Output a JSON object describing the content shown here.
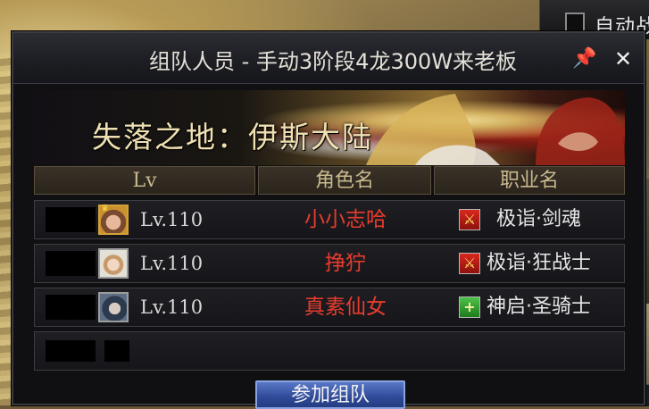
{
  "background": {
    "auto_checkbox_label": "自动战"
  },
  "window": {
    "title": "组队人员 - 手动3阶段4龙300W来老板",
    "pin_icon": "pin-icon",
    "close_icon": "close-icon",
    "pin_glyph": "📌",
    "close_glyph": "✕"
  },
  "banner": {
    "dungeon_name": "失落之地：伊斯大陆"
  },
  "table": {
    "headers": {
      "level": "Lv",
      "character_name": "角色名",
      "job_name": "职业名"
    },
    "rows": [
      {
        "level": "Lv.110",
        "name": "小小志哈",
        "job": "极诣·剑魂",
        "job_type": "attack",
        "leader": true
      },
      {
        "level": "Lv.110",
        "name": "挣狞",
        "job": "极诣·狂战士",
        "job_type": "attack",
        "leader": false
      },
      {
        "level": "Lv.110",
        "name": "真素仙女",
        "job": "神启·圣骑士",
        "job_type": "support",
        "leader": false
      }
    ]
  },
  "join_button_label": "参加组队",
  "colors": {
    "player_name": "#e83c2e",
    "header_text": "#c9b98f",
    "join_button": "#2f4a98"
  }
}
